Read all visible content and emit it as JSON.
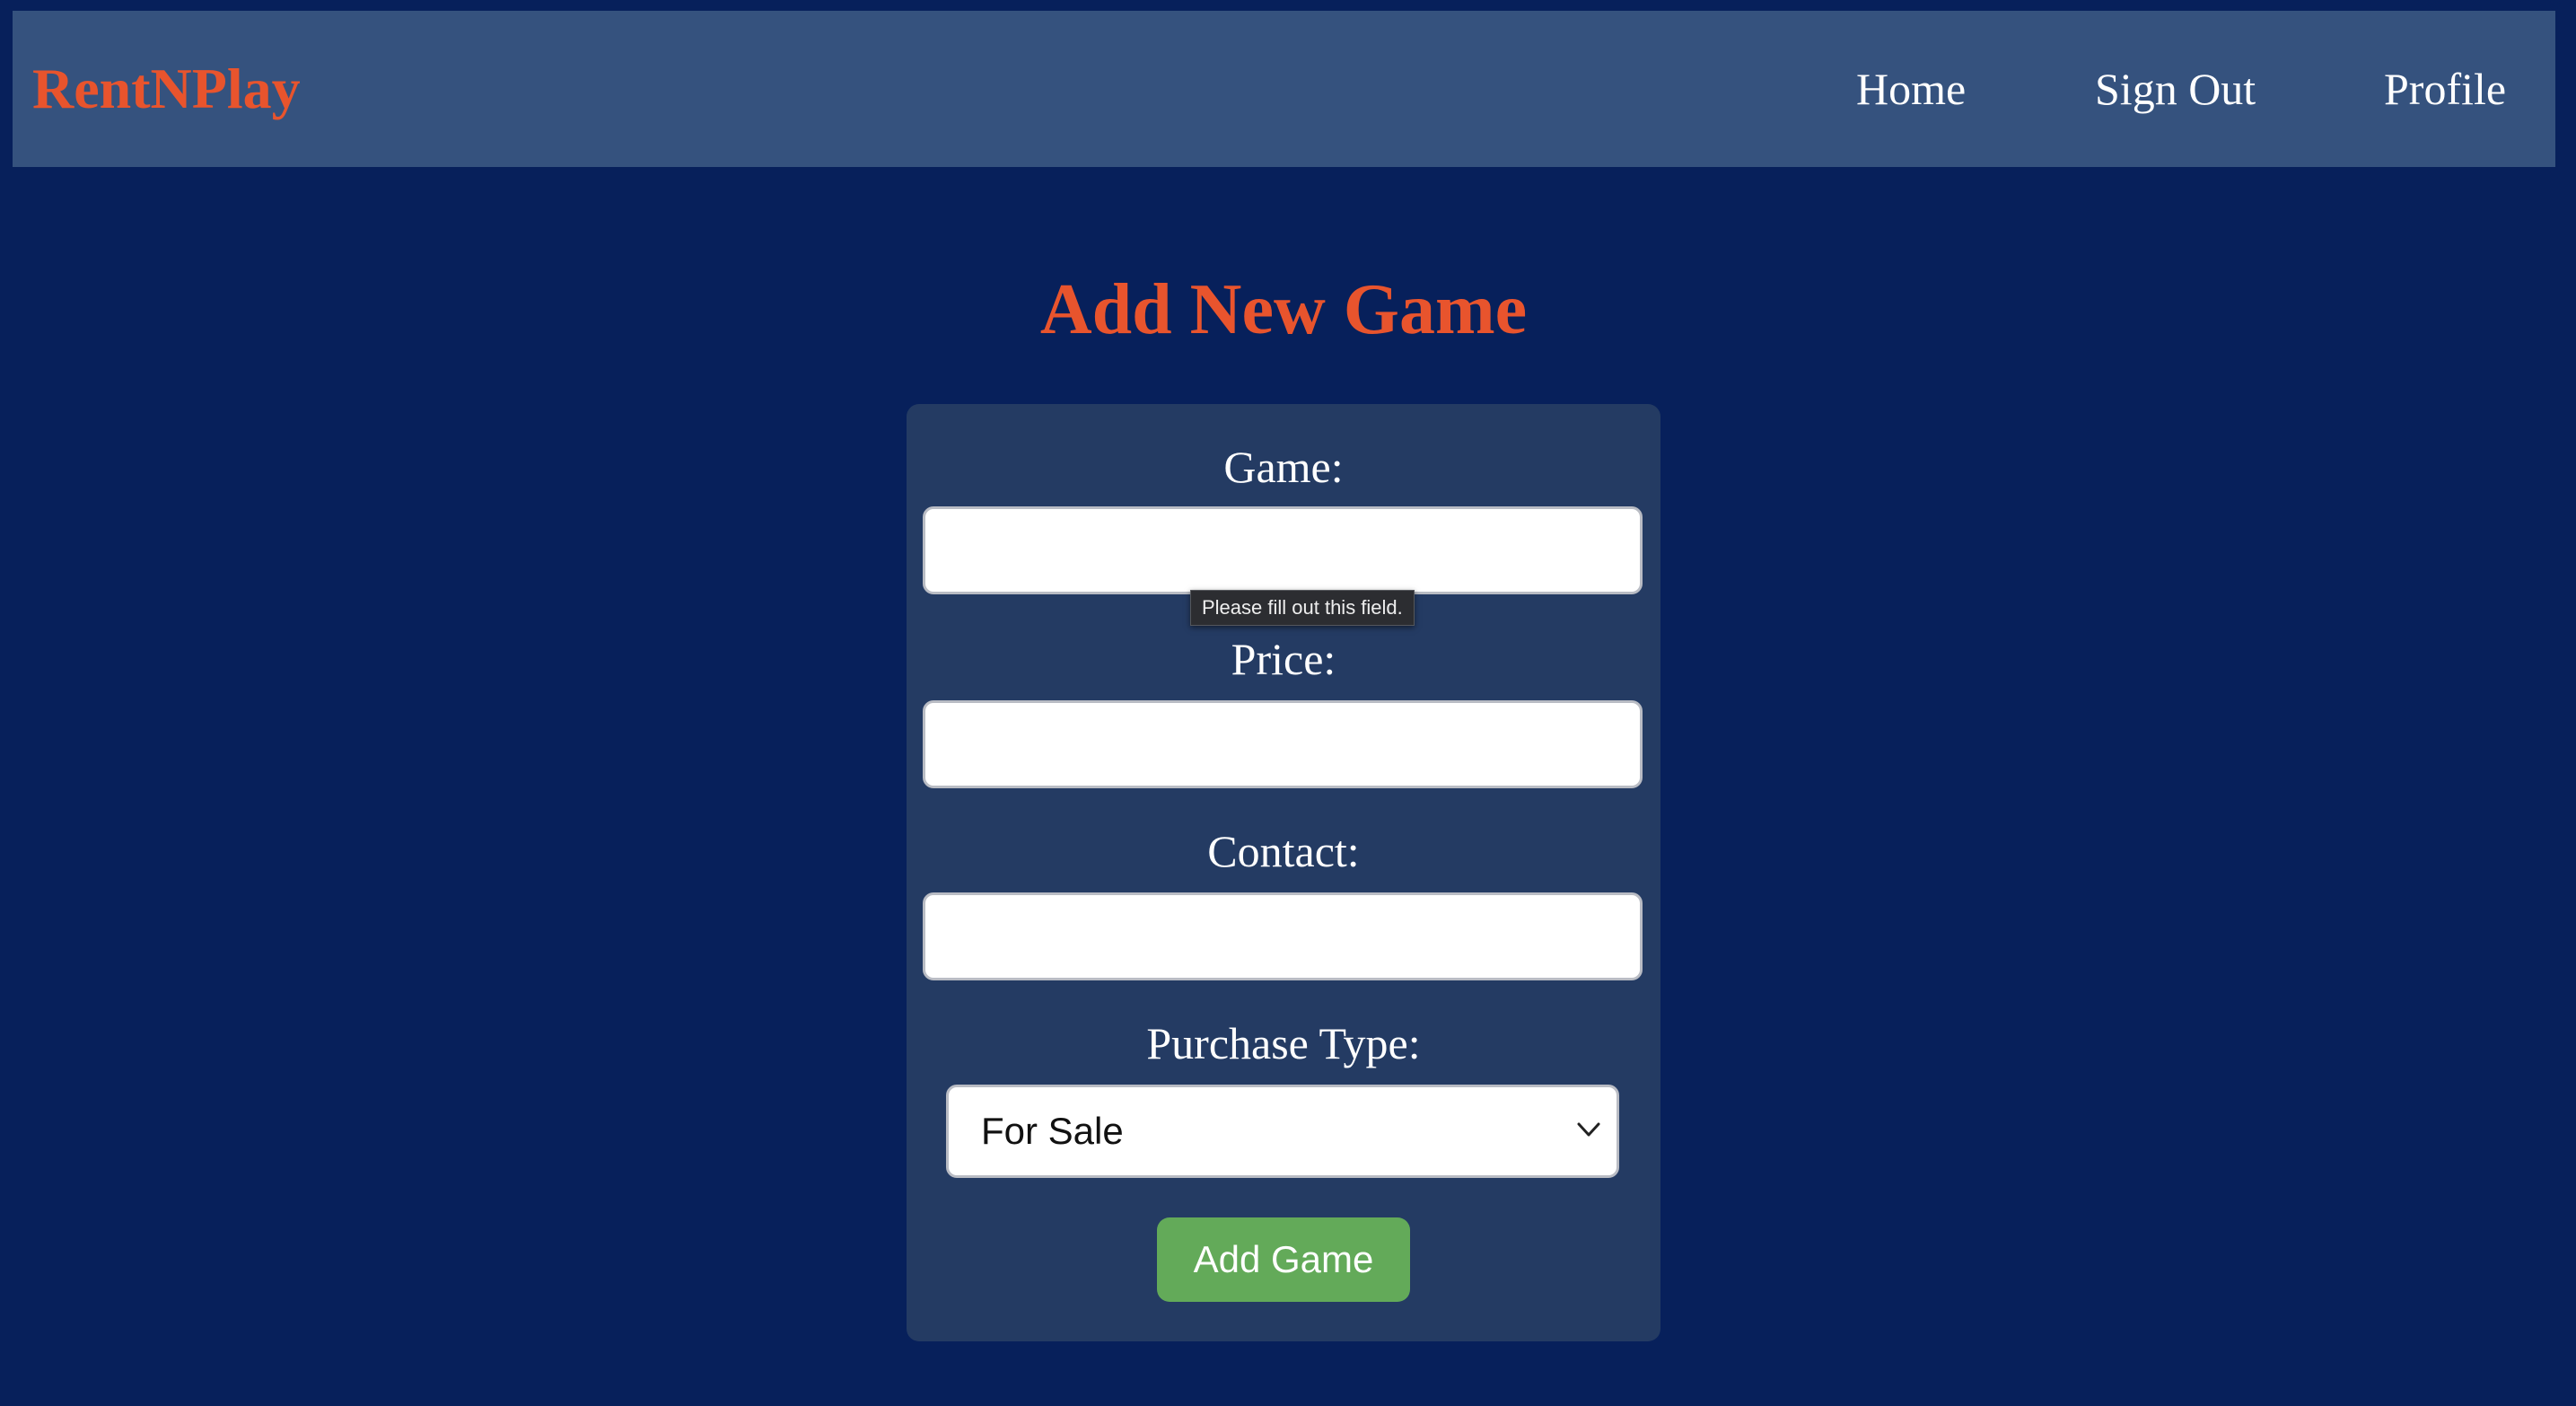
{
  "navbar": {
    "brand": "RentNPlay",
    "links": {
      "home": "Home",
      "sign_out": "Sign Out",
      "profile": "Profile"
    }
  },
  "page": {
    "title": "Add New Game"
  },
  "form": {
    "game_label": "Game:",
    "game_value": "",
    "price_label": "Price:",
    "price_value": "",
    "contact_label": "Contact:",
    "contact_value": "",
    "purchase_type_label": "Purchase Type:",
    "purchase_type_selected": "For Sale",
    "submit_label": "Add Game",
    "validation_tooltip": "Please fill out this field."
  },
  "colors": {
    "background": "#07205b",
    "navbar": "#35527e",
    "card": "#243b63",
    "accent": "#e8542d",
    "submit": "#63aa59"
  },
  "icons": {
    "select_arrow": "chevron-down-icon"
  }
}
